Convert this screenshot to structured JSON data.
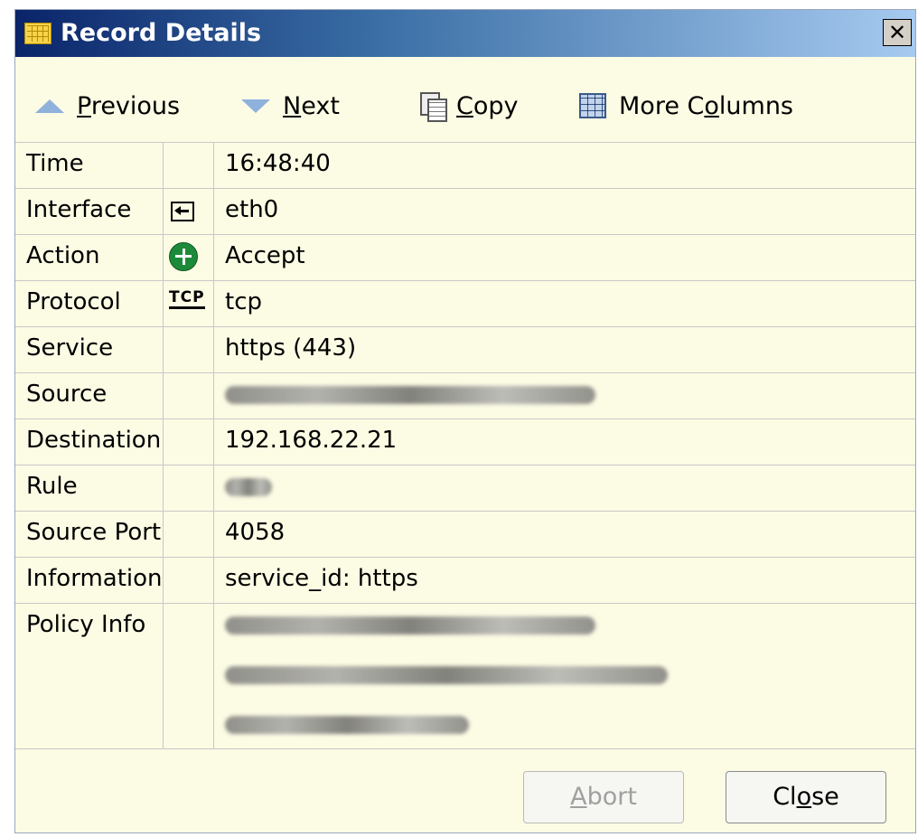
{
  "window": {
    "title": "Record Details",
    "close_glyph": "✕"
  },
  "toolbar": {
    "previous": {
      "pre": "",
      "acc": "P",
      "post": "revious",
      "icon": "triangle-up-icon"
    },
    "next": {
      "pre": "",
      "acc": "N",
      "post": "ext",
      "icon": "triangle-down-icon"
    },
    "copy": {
      "pre": "",
      "acc": "C",
      "post": "opy",
      "icon": "copy-icon"
    },
    "more_columns": {
      "pre": "More C",
      "acc": "o",
      "post": "lumns",
      "icon": "grid-icon"
    }
  },
  "rows": [
    {
      "label": "Time",
      "value": "16:48:40",
      "icon": ""
    },
    {
      "label": "Interface",
      "value": "eth0",
      "icon": "interface-icon"
    },
    {
      "label": "Action",
      "value": "Accept",
      "icon": "accept-icon"
    },
    {
      "label": "Protocol",
      "value": "tcp",
      "icon": "tcp-icon",
      "icon_text": "TCP"
    },
    {
      "label": "Service",
      "value": "https (443)",
      "icon": ""
    },
    {
      "label": "Source",
      "value": "",
      "icon": "",
      "redacted": true
    },
    {
      "label": "Destination",
      "value": "192.168.22.21",
      "icon": ""
    },
    {
      "label": "Rule",
      "value": "",
      "icon": "",
      "redacted": true
    },
    {
      "label": "Source Port",
      "value": "4058",
      "icon": ""
    },
    {
      "label": "Information",
      "value": "service_id: https",
      "icon": ""
    },
    {
      "label": "Policy Info",
      "value": "",
      "icon": "",
      "redacted": true
    }
  ],
  "footer": {
    "abort": {
      "pre": "",
      "acc": "A",
      "post": "bort",
      "disabled": true
    },
    "close": {
      "pre": "Cl",
      "acc": "o",
      "post": "se",
      "disabled": false
    }
  },
  "colors": {
    "title_bar_start": "#0a246a",
    "title_bar_end": "#a6caf0",
    "dialog_bg": "#fcfbe4",
    "accept_green": "#1d8a3a"
  }
}
